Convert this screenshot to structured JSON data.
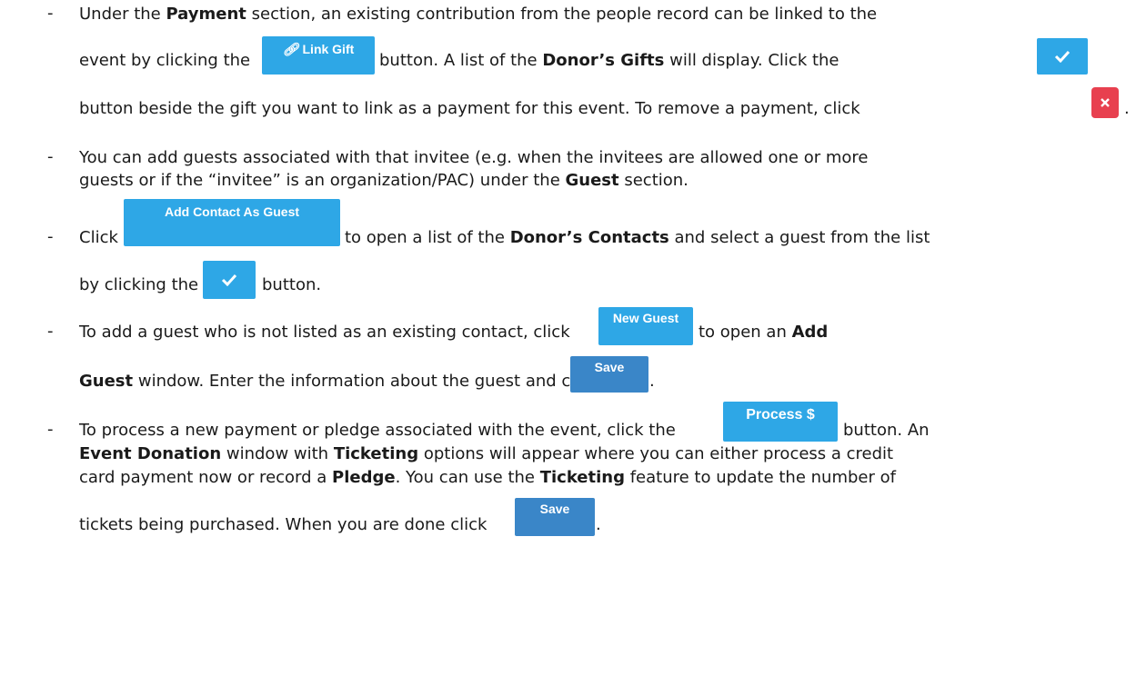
{
  "bullets": [
    {
      "dash": "-",
      "lines": [
        {
          "pre": "Under the ",
          "b1": "Payment",
          "post": " section, an existing contribution from the people record can be linked to the"
        },
        {
          "pre": "event by clicking the",
          "mid": "button. A list of the ",
          "b1": "Donor’s Gifts",
          "post": " will display. Click the"
        },
        {
          "pre": "button beside the gift you want to link as a payment for this event. To remove a payment, click",
          "post": "."
        }
      ]
    },
    {
      "dash": "-",
      "lines": [
        {
          "pre": "You can add guests associated with that invitee (e.g. when the invitees are allowed one or more"
        },
        {
          "pre": "guests or if the “invitee” is an organization/PAC) under the ",
          "b1": "Guest",
          "post": " section."
        }
      ]
    },
    {
      "dash": "-",
      "lines": [
        {
          "pre": "Click",
          "mid": "to open a list of the ",
          "b1": "Donor’s Contacts",
          "post": " and select a guest from the list"
        },
        {
          "pre": "by clicking the",
          "post": "button."
        }
      ]
    },
    {
      "dash": "-",
      "lines": [
        {
          "pre": "To add a guest who is not listed as an existing contact, click",
          "mid": "to open an ",
          "b1": "Add"
        },
        {
          "b1": "Guest",
          "post": " window. Enter the information about the guest and click",
          "end": "."
        }
      ]
    },
    {
      "dash": "-",
      "lines": [
        {
          "pre": "To process a new payment or pledge associated with the event, click the",
          "post": "button. An"
        },
        {
          "b1": "Event Donation",
          "mid": " window with ",
          "b2": "Ticketing",
          "post": " options will appear where you can either process a credit"
        },
        {
          "pre": "card payment now or record a ",
          "b1": "Pledge",
          "mid": ". You can use the ",
          "b2": "Ticketing",
          "post": " feature to update the number of"
        },
        {
          "pre": "tickets being purchased.  When you are done click",
          "post": "."
        }
      ]
    }
  ],
  "buttons": {
    "link_gift": "Link Gift",
    "add_contact_as_guest": "Add Contact As Guest",
    "new_guest": "New Guest",
    "save": "Save",
    "process": "Process $",
    "check_icon": "check-icon",
    "remove_icon": "close-icon"
  },
  "colors": {
    "button_blue": "#2ea7e6",
    "save_blue": "#3a86c8",
    "remove_red": "#e8404f"
  }
}
